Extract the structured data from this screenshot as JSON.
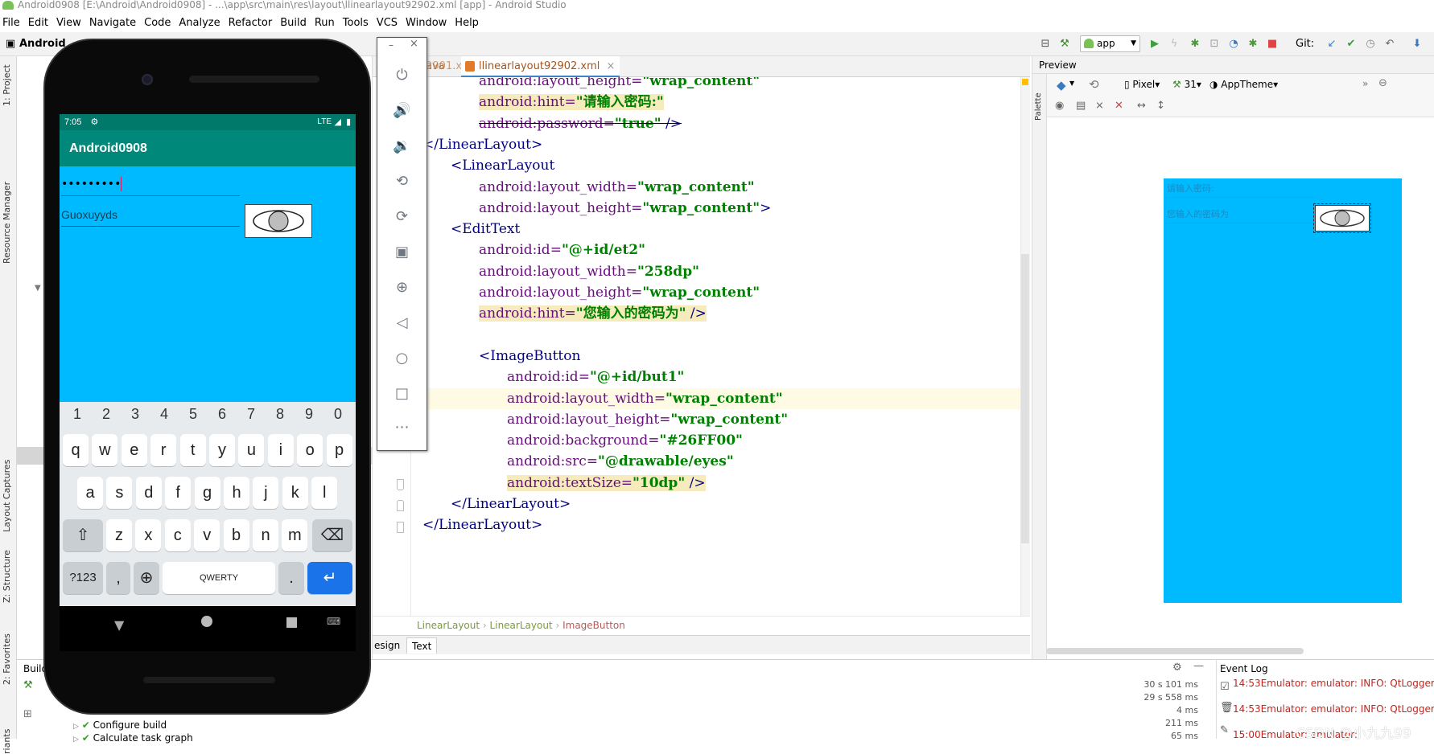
{
  "window": {
    "title": "Android0908 [E:\\Android\\Android0908] - ...\\app\\src\\main\\res\\layout\\llinearlayout92902.xml [app] - Android Studio"
  },
  "menu": [
    "File",
    "Edit",
    "View",
    "Navigate",
    "Code",
    "Analyze",
    "Refactor",
    "Build",
    "Run",
    "Tools",
    "VCS",
    "Window",
    "Help"
  ],
  "toolbar": {
    "project": "Android",
    "run_config": "app",
    "git_label": "Git:"
  },
  "side_tabs": {
    "project": "1: Project",
    "resource_manager": "Resource Manager",
    "layout_captures": "Layout Captures",
    "structure": "Z: Structure",
    "favorites": "2: Favorites",
    "variants": "riants"
  },
  "editor_tabs": [
    {
      "label": "arlayout92901.xml",
      "active": false
    },
    {
      "label": "ava",
      "active": false
    },
    {
      "label": "llinearlayout92902.xml",
      "active": true
    }
  ],
  "code_lines": [
    {
      "indent": 2,
      "parts": [
        {
          "t": "at",
          "v": "android:layout_height="
        },
        {
          "t": "vl",
          "v": "\"wrap_content\""
        }
      ]
    },
    {
      "indent": 2,
      "hl": true,
      "parts": [
        {
          "t": "at",
          "v": "android:hint="
        },
        {
          "t": "vl",
          "v": "\"请输入密码:\""
        }
      ]
    },
    {
      "indent": 2,
      "strike": true,
      "parts": [
        {
          "t": "at",
          "v": "android:password="
        },
        {
          "t": "vl",
          "v": "\"true\""
        },
        {
          "t": "tg",
          "v": " />"
        }
      ]
    },
    {
      "indent": 0,
      "parts": [
        {
          "t": "tg",
          "v": "</LinearLayout>"
        }
      ]
    },
    {
      "indent": 1,
      "parts": [
        {
          "t": "tg",
          "v": "<LinearLayout"
        }
      ]
    },
    {
      "indent": 2,
      "parts": [
        {
          "t": "at",
          "v": "android:layout_width="
        },
        {
          "t": "vl",
          "v": "\"wrap_content\""
        }
      ]
    },
    {
      "indent": 2,
      "parts": [
        {
          "t": "at",
          "v": "android:layout_height="
        },
        {
          "t": "vl",
          "v": "\"wrap_content\""
        },
        {
          "t": "tg",
          "v": ">"
        }
      ]
    },
    {
      "indent": 1,
      "parts": [
        {
          "t": "tg",
          "v": "<EditText"
        }
      ]
    },
    {
      "indent": 2,
      "parts": [
        {
          "t": "at",
          "v": "android:id="
        },
        {
          "t": "vl",
          "v": "\"@+id/et2\""
        }
      ]
    },
    {
      "indent": 2,
      "parts": [
        {
          "t": "at",
          "v": "android:layout_width="
        },
        {
          "t": "vl",
          "v": "\"258dp\""
        }
      ]
    },
    {
      "indent": 2,
      "parts": [
        {
          "t": "at",
          "v": "android:layout_height="
        },
        {
          "t": "vl",
          "v": "\"wrap_content\""
        }
      ]
    },
    {
      "indent": 2,
      "hl": true,
      "parts": [
        {
          "t": "at",
          "v": "android:hint="
        },
        {
          "t": "vl",
          "v": "\"您输入的密码为\""
        },
        {
          "t": "tg",
          "v": " />"
        }
      ]
    },
    {
      "indent": 2,
      "parts": []
    },
    {
      "indent": 2,
      "parts": [
        {
          "t": "tg",
          "v": "<ImageButton"
        }
      ]
    },
    {
      "indent": 3,
      "parts": [
        {
          "t": "at",
          "v": "android:id="
        },
        {
          "t": "vl",
          "v": "\"@+id/but1\""
        }
      ]
    },
    {
      "indent": 3,
      "cur": true,
      "parts": [
        {
          "t": "at",
          "v": "android:layout_width="
        },
        {
          "t": "vl",
          "v": "\"wrap_content\""
        }
      ]
    },
    {
      "indent": 3,
      "parts": [
        {
          "t": "at",
          "v": "android:layout_height="
        },
        {
          "t": "vl",
          "v": "\"wrap_content\""
        }
      ]
    },
    {
      "indent": 3,
      "parts": [
        {
          "t": "at",
          "v": "android:background="
        },
        {
          "t": "vl",
          "v": "\"#26FF00\""
        }
      ]
    },
    {
      "indent": 3,
      "parts": [
        {
          "t": "at",
          "v": "android:src="
        },
        {
          "t": "vl",
          "v": "\"@drawable/eyes\""
        }
      ]
    },
    {
      "indent": 3,
      "hl": true,
      "parts": [
        {
          "t": "at",
          "v": "android:textSize="
        },
        {
          "t": "vl",
          "v": "\"10dp\""
        },
        {
          "t": "tg",
          "v": " />"
        }
      ]
    },
    {
      "indent": 1,
      "parts": [
        {
          "t": "tg",
          "v": "</LinearLayout>"
        }
      ]
    },
    {
      "indent": 0,
      "parts": [
        {
          "t": "tg",
          "v": "</LinearLayout>"
        }
      ]
    }
  ],
  "breadcrumb": [
    "LinearLayout",
    "LinearLayout",
    "ImageButton"
  ],
  "bottom_tabs": {
    "design": "esign",
    "text": "Text"
  },
  "preview": {
    "title": "Preview",
    "device": "Pixel",
    "api": "31",
    "theme": "AppTheme",
    "palette": "Palette",
    "hint1": "请输入密码:",
    "hint2": "您输入的密码为"
  },
  "build": {
    "title": "Build",
    "items": [
      "Configure build",
      "Calculate task graph"
    ],
    "times": [
      "30 s 101 ms",
      "29 s 558 ms",
      "4 ms",
      "211 ms",
      "65 ms"
    ]
  },
  "event_log": {
    "title": "Event Log",
    "lines": [
      "14:53Emulator: emulator: INFO: QtLogger",
      "14:53Emulator: emulator: INFO: QtLogger",
      "15:00Emulator: emulator:"
    ]
  },
  "watermark": "CSDN @小九九99",
  "phone": {
    "time": "7:05",
    "network": "LTE",
    "app_title": "Android0908",
    "password_masked": "•••••••••",
    "shown_text": "Guoxuyyds",
    "number_row": [
      "1",
      "2",
      "3",
      "4",
      "5",
      "6",
      "7",
      "8",
      "9",
      "0"
    ],
    "row1": [
      "q",
      "w",
      "e",
      "r",
      "t",
      "y",
      "u",
      "i",
      "o",
      "p"
    ],
    "row2": [
      "a",
      "s",
      "d",
      "f",
      "g",
      "h",
      "j",
      "k",
      "l"
    ],
    "row3": [
      "z",
      "x",
      "c",
      "v",
      "b",
      "n",
      "m"
    ],
    "sym_key": "?123",
    "comma_key": ",",
    "space_key": "QWERTY",
    "period_key": "."
  },
  "colors": {
    "phone_bg": "#00baff",
    "appbar": "#00897b",
    "statusbar": "#00796b",
    "tag": "#000080",
    "attr": "#660e7a",
    "value": "#008000"
  }
}
